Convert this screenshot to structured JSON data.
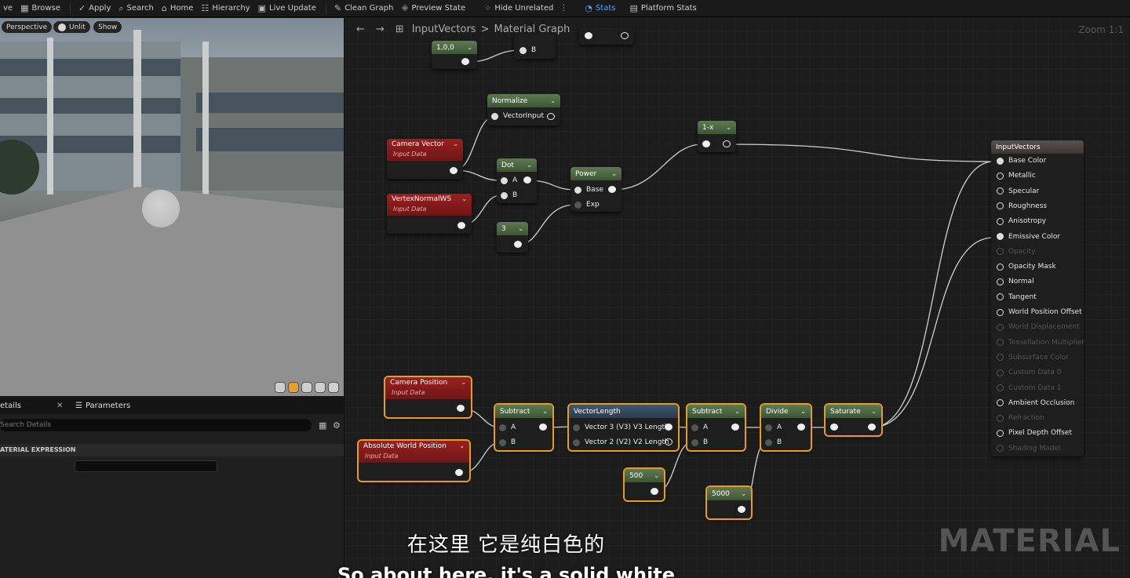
{
  "toolbar": {
    "save": "ve",
    "browse": "Browse",
    "apply": "Apply",
    "search": "Search",
    "home": "Home",
    "hierarchy": "Hierarchy",
    "live_update": "Live Update",
    "clean_graph": "Clean Graph",
    "preview_state": "Preview State",
    "hide_unrelated": "Hide Unrelated",
    "stats": "Stats",
    "platform_stats": "Platform Stats"
  },
  "viewport": {
    "perspective": "Perspective",
    "unlit": "Unlit",
    "show": "Show"
  },
  "details": {
    "tab_details": "etails",
    "tab_parameters": "Parameters",
    "search_placeholder": "Search Details",
    "section": "ATERIAL EXPRESSION"
  },
  "graph": {
    "breadcrumb_root": "InputVectors",
    "breadcrumb_sep": ">",
    "breadcrumb_page": "Material Graph",
    "zoom": "Zoom 1:1",
    "watermark": "MATERIAL",
    "nodes": {
      "const_100": "1,0,0",
      "normalize": "Normalize",
      "normalize_in": "VectorInput",
      "camera_vector": "Camera Vector",
      "input_data": "Input Data",
      "dot": "Dot",
      "pin_a": "A",
      "pin_b": "B",
      "power": "Power",
      "pin_base": "Base",
      "pin_exp": "Exp",
      "one_minus": "1-x",
      "vertex_normal": "VertexNormalWS",
      "const_3": "3",
      "camera_position": "Camera Position",
      "absolute_world": "Absolute World Position",
      "subtract": "Subtract",
      "vector_length": "VectorLength",
      "v3_length": "Vector 3 (V3) V3 Length",
      "v2_length": "Vector 2 (V2) V2 Length",
      "divide": "Divide",
      "saturate": "Saturate",
      "const_500": "500",
      "const_5000": "5000"
    },
    "result": {
      "title": "InputVectors",
      "pins": [
        {
          "label": "Base Color",
          "enabled": true
        },
        {
          "label": "Metallic",
          "enabled": true
        },
        {
          "label": "Specular",
          "enabled": true
        },
        {
          "label": "Roughness",
          "enabled": true
        },
        {
          "label": "Anisotropy",
          "enabled": true
        },
        {
          "label": "Emissive Color",
          "enabled": true
        },
        {
          "label": "Opacity",
          "enabled": false
        },
        {
          "label": "Opacity Mask",
          "enabled": true
        },
        {
          "label": "Normal",
          "enabled": true
        },
        {
          "label": "Tangent",
          "enabled": true
        },
        {
          "label": "World Position Offset",
          "enabled": true
        },
        {
          "label": "World Displacement",
          "enabled": false
        },
        {
          "label": "Tessellation Multiplier",
          "enabled": false
        },
        {
          "label": "Subsurface Color",
          "enabled": false
        },
        {
          "label": "Custom Data 0",
          "enabled": false
        },
        {
          "label": "Custom Data 1",
          "enabled": false
        },
        {
          "label": "Ambient Occlusion",
          "enabled": true
        },
        {
          "label": "Refraction",
          "enabled": false
        },
        {
          "label": "Pixel Depth Offset",
          "enabled": true
        },
        {
          "label": "Shading Model",
          "enabled": false
        }
      ]
    }
  },
  "subtitles": {
    "cn": "在这里 它是纯白色的",
    "en": "So about here, it's a solid white"
  }
}
